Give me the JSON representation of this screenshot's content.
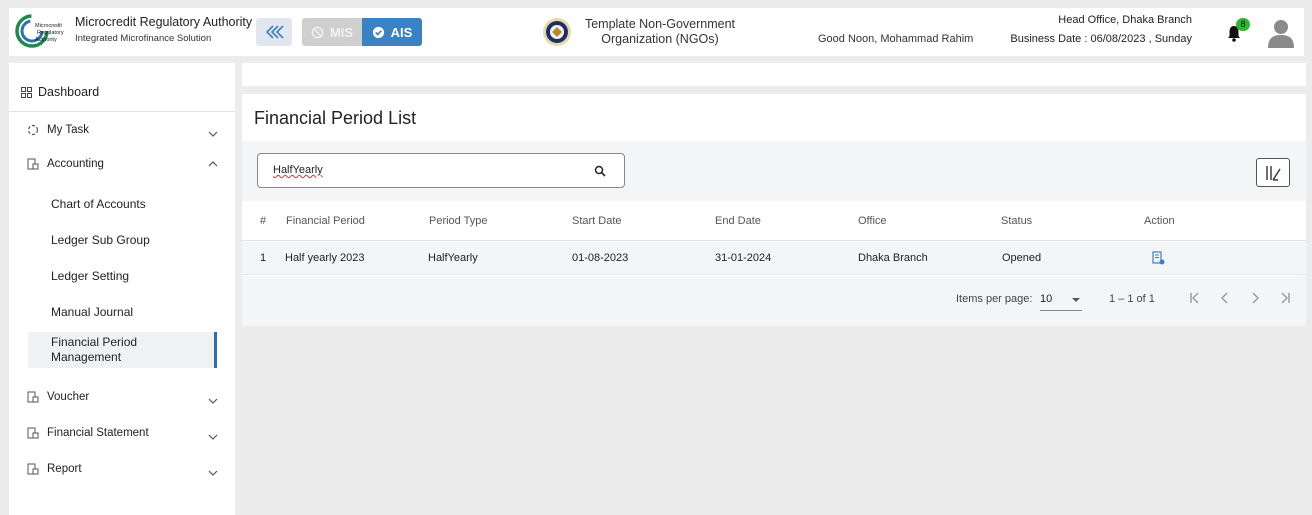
{
  "header": {
    "org_name": "Microcredit Regulatory Authority",
    "org_subtitle": "Integrated Microfinance Solution",
    "logo_text": [
      "Microcredit",
      "Regulatory",
      "Authority"
    ],
    "mis_label": "MIS",
    "ais_label": "AIS",
    "ngo_name_line1": "Template Non-Government",
    "ngo_name_line2": "Organization (NGOs)",
    "greeting": "Good Noon, Mohammad Rahim",
    "branch": "Head Office, Dhaka Branch",
    "business_date": "Business Date : 06/08/2023 , Sunday",
    "notification_count": "8",
    "accent_color": "#3b82c4"
  },
  "sidebar": {
    "dashboard": "Dashboard",
    "items": [
      {
        "label": "My Task",
        "icon": "spinner-icon",
        "expanded": false
      },
      {
        "label": "Accounting",
        "icon": "ledger-icon",
        "expanded": true
      },
      {
        "label": "Voucher",
        "icon": "ledger-icon",
        "expanded": false
      },
      {
        "label": "Financial Statement",
        "icon": "ledger-icon",
        "expanded": false
      },
      {
        "label": "Report",
        "icon": "ledger-icon",
        "expanded": false
      }
    ],
    "accounting_children": [
      "Chart of Accounts",
      "Ledger Sub Group",
      "Ledger Setting",
      "Manual Journal",
      "Financial Period Management"
    ],
    "active_child": "Financial Period Management"
  },
  "main": {
    "title": "Financial Period List",
    "search_value": "HalfYearly",
    "columns": [
      "#",
      "Financial Period",
      "Period Type",
      "Start Date",
      "End Date",
      "Office",
      "Status",
      "Action"
    ],
    "rows": [
      [
        "1",
        "Half yearly 2023",
        "HalfYearly",
        "01-08-2023",
        "31-01-2024",
        "Dhaka Branch",
        "Opened"
      ]
    ],
    "pagination": {
      "items_per_page_label": "Items per page:",
      "items_per_page": "10",
      "range": "1 – 1 of 1"
    }
  }
}
